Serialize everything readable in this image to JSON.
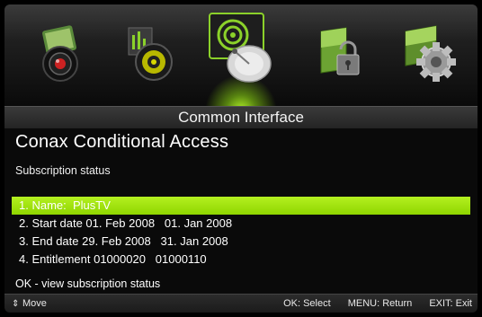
{
  "menu_icons": [
    {
      "name": "picture-camera-icon"
    },
    {
      "name": "sound-speaker-icon"
    },
    {
      "name": "satellite-dish-icon"
    },
    {
      "name": "lock-shield-icon"
    },
    {
      "name": "settings-gear-icon"
    }
  ],
  "selected_icon_index": 2,
  "accent_color": "#9be21a",
  "title": "Common Interface",
  "heading": "Conax Conditional Access",
  "subtitle": "Subscription status",
  "items": [
    {
      "label": "1. Name:  PlusTV",
      "selected": true
    },
    {
      "label": "2. Start date 01. Feb 2008   01. Jan 2008",
      "selected": false
    },
    {
      "label": "3. End date 29. Feb 2008   31. Jan 2008",
      "selected": false
    },
    {
      "label": "4. Entitlement 01000020   01000110",
      "selected": false
    }
  ],
  "hint": "OK - view subscription status",
  "footer": {
    "move": "Move",
    "select": "OK: Select",
    "return": "MENU: Return",
    "exit": "EXIT: Exit"
  }
}
